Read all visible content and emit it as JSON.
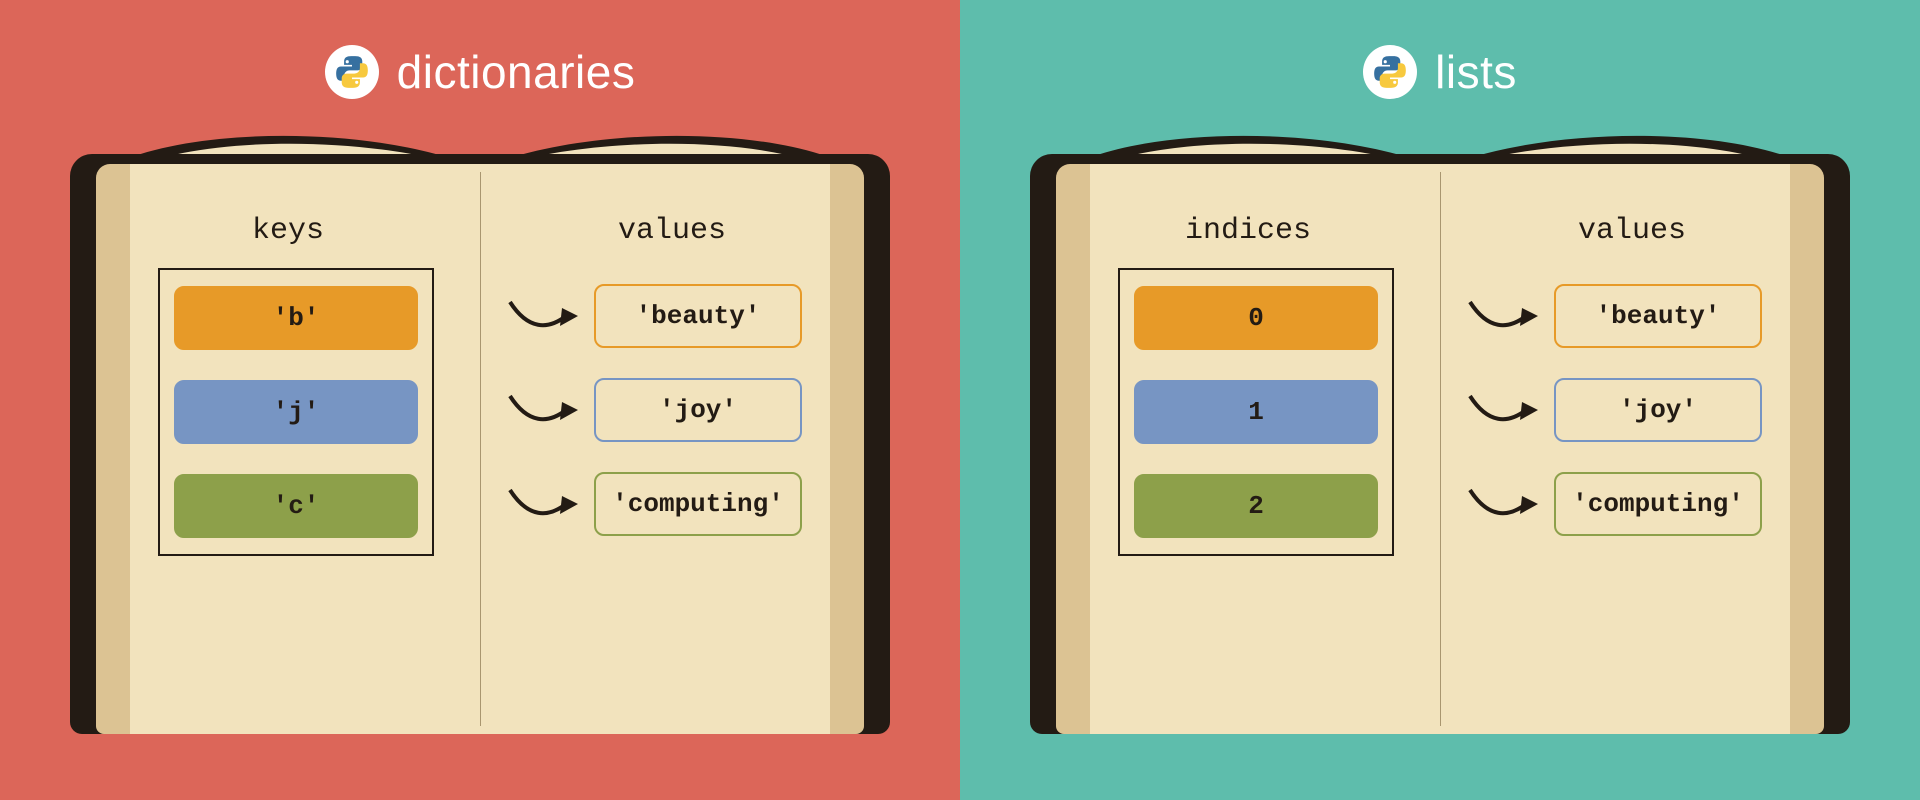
{
  "left": {
    "title": "dictionaries",
    "keys_label": "keys",
    "values_label": "values",
    "rows": [
      {
        "key": "'b'",
        "value": "'beauty'",
        "color": "orange"
      },
      {
        "key": "'j'",
        "value": "'joy'",
        "color": "blue"
      },
      {
        "key": "'c'",
        "value": "'computing'",
        "color": "green"
      }
    ]
  },
  "right": {
    "title": "lists",
    "keys_label": "indices",
    "values_label": "values",
    "rows": [
      {
        "key": "0",
        "value": "'beauty'",
        "color": "orange"
      },
      {
        "key": "1",
        "value": "'joy'",
        "color": "blue"
      },
      {
        "key": "2",
        "value": "'computing'",
        "color": "green"
      }
    ]
  },
  "colors": {
    "left_bg": "#dc6659",
    "right_bg": "#5ebdac",
    "orange": "#e79a28",
    "blue": "#7795c3",
    "green": "#8da04a",
    "book": "#231b14",
    "page": "#f2e3bd"
  }
}
